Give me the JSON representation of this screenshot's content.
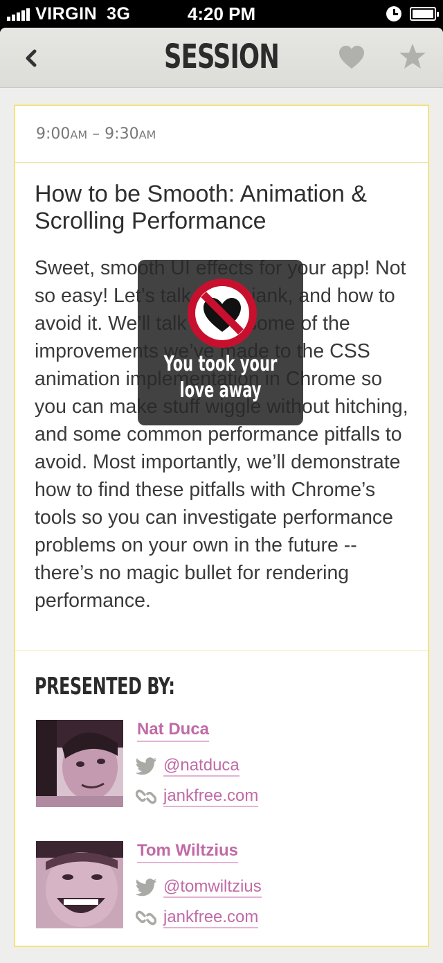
{
  "status_bar": {
    "carrier": "VIRGIN",
    "network": "3G",
    "time": "4:20 PM"
  },
  "nav": {
    "title": "SESSION",
    "back_icon": "chevron-left-icon",
    "heart_icon": "heart-icon",
    "star_icon": "star-icon"
  },
  "session": {
    "time_start": "9:00",
    "time_start_suffix": "AM",
    "time_sep": " – ",
    "time_end": "9:30",
    "time_end_suffix": "AM",
    "title": "How to be Smooth: Animation & Scrolling Performance",
    "description": "Sweet, smooth UI effects for your app! Not so easy! Let’s talk about jank, and how to avoid it. We’ll talk about some of the improvements we’ve made to the CSS animation implementation in Chrome so you can make stuff wiggle without hitching, and some common performance pitfalls to avoid. Most importantly, we’ll demonstrate how to find these pitfalls with Chrome’s tools so you can investigate performance problems on your own in the future -- there’s no magic bullet for rendering performance."
  },
  "presenters": {
    "heading": "PRESENTED BY:",
    "items": [
      {
        "name": "Nat Duca",
        "twitter": "@natduca",
        "website": "jankfree.com"
      },
      {
        "name": "Tom Wiltzius",
        "twitter": "@tomwiltzius",
        "website": "jankfree.com"
      }
    ]
  },
  "toast": {
    "line1": "You took your",
    "line2": "love away",
    "icon": "no-heart-icon"
  },
  "colors": {
    "link": "#c06aa6",
    "card_border": "#f5e27a",
    "toast_red": "#c8102e"
  }
}
